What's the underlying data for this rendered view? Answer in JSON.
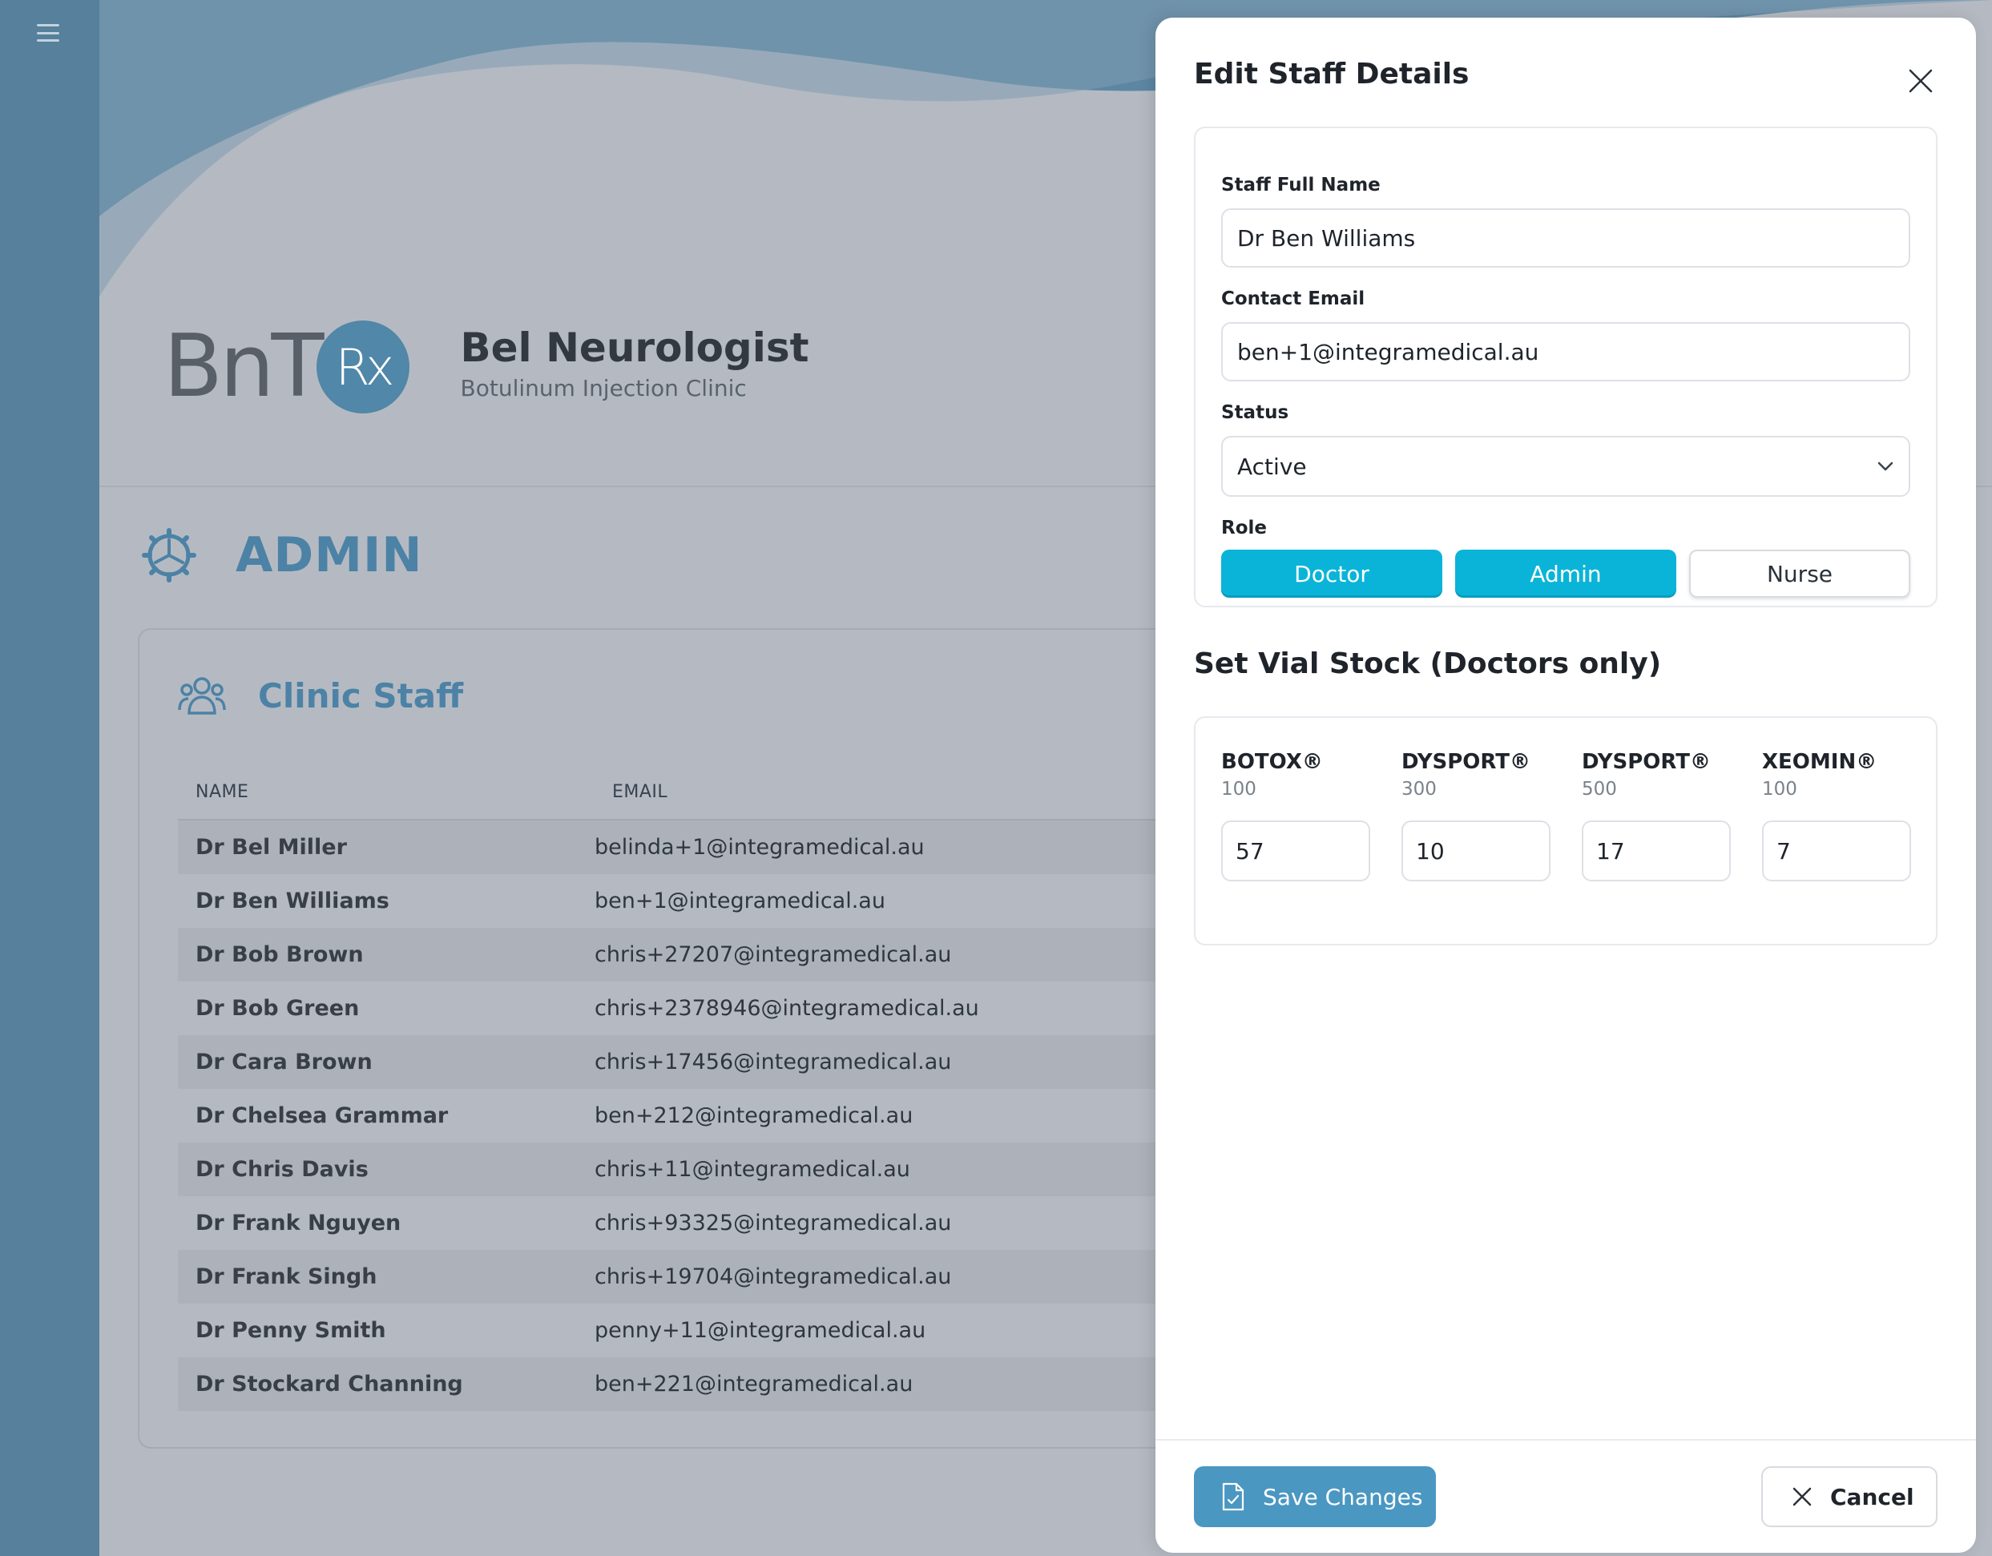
{
  "nav": {
    "menu_icon": "hamburger-icon"
  },
  "brand": {
    "logo_text": "BnT",
    "logo_badge": "Rx",
    "title": "Bel Neurologist",
    "subtitle": "Botulinum Injection Clinic"
  },
  "admin": {
    "title": "ADMIN",
    "icon": "gear-icon"
  },
  "staff": {
    "title": "Clinic Staff",
    "icon": "people-icon",
    "columns": [
      "NAME",
      "EMAIL"
    ],
    "rows": [
      {
        "name": "Dr Bel Miller",
        "email": "belinda+1@integramedical.au"
      },
      {
        "name": "Dr Ben Williams",
        "email": "ben+1@integramedical.au"
      },
      {
        "name": "Dr Bob Brown",
        "email": "chris+27207@integramedical.au"
      },
      {
        "name": "Dr Bob Green",
        "email": "chris+2378946@integramedical.au"
      },
      {
        "name": "Dr Cara Brown",
        "email": "chris+17456@integramedical.au"
      },
      {
        "name": "Dr Chelsea Grammar",
        "email": "ben+212@integramedical.au"
      },
      {
        "name": "Dr Chris Davis",
        "email": "chris+11@integramedical.au"
      },
      {
        "name": "Dr Frank Nguyen",
        "email": "chris+93325@integramedical.au"
      },
      {
        "name": "Dr Frank Singh",
        "email": "chris+19704@integramedical.au"
      },
      {
        "name": "Dr Penny Smith",
        "email": "penny+11@integramedical.au"
      },
      {
        "name": "Dr Stockard Channing",
        "email": "ben+221@integramedical.au"
      }
    ]
  },
  "modal": {
    "title": "Edit Staff Details",
    "name_label": "Staff Full Name",
    "name_value": "Dr Ben Williams",
    "email_label": "Contact Email",
    "email_value": "ben+1@integramedical.au",
    "status_label": "Status",
    "status_value": "Active",
    "role_label": "Role",
    "roles": [
      {
        "label": "Doctor",
        "selected": true
      },
      {
        "label": "Admin",
        "selected": true
      },
      {
        "label": "Nurse",
        "selected": false
      }
    ],
    "vial_title": "Set Vial Stock (Doctors only)",
    "vials": [
      {
        "name": "BOTOX®",
        "size": "100",
        "value": "57"
      },
      {
        "name": "DYSPORT®",
        "size": "300",
        "value": "10"
      },
      {
        "name": "DYSPORT®",
        "size": "500",
        "value": "17"
      },
      {
        "name": "XEOMIN®",
        "size": "100",
        "value": "7"
      }
    ],
    "save_label": "Save Changes",
    "cancel_label": "Cancel"
  },
  "colors": {
    "accent": "#4a97c2",
    "role_selected": "#0ab4d8",
    "heading_blue": "#4c82a5",
    "overlay_bg": "#b5bac2",
    "sidebar": "#56809b"
  }
}
